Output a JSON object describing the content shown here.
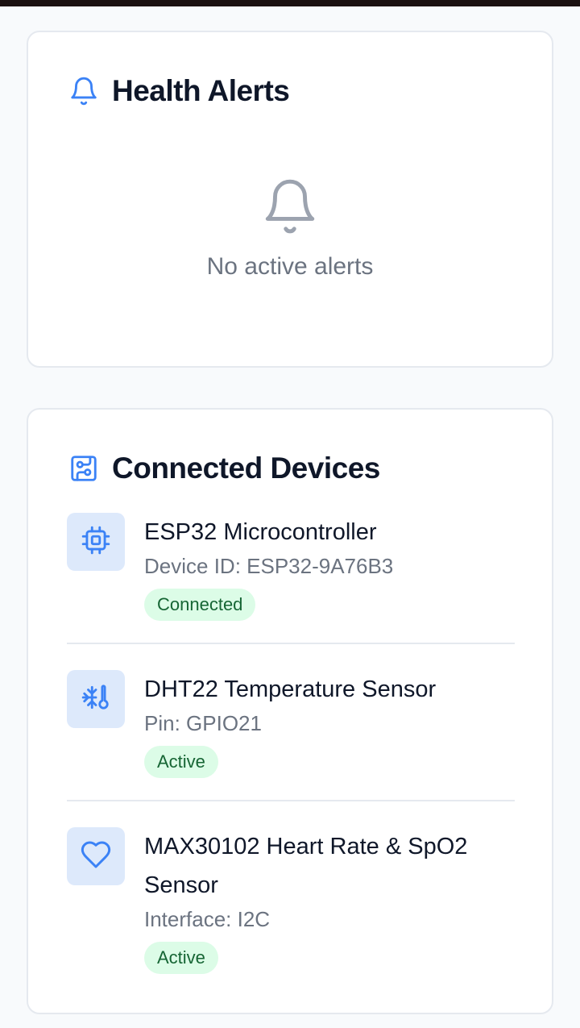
{
  "alerts": {
    "title": "Health Alerts",
    "empty_message": "No active alerts",
    "header_icon": "bell-icon",
    "empty_icon": "bell-icon"
  },
  "devices": {
    "title": "Connected Devices",
    "header_icon": "circuit-board-icon",
    "items": [
      {
        "name": "ESP32 Microcontroller",
        "detail": "Device ID: ESP32-9A76B3",
        "status": "Connected",
        "icon": "cpu-chip-icon"
      },
      {
        "name": "DHT22 Temperature Sensor",
        "detail": "Pin: GPIO21",
        "status": "Active",
        "icon": "thermometer-snowflake-icon"
      },
      {
        "name": "MAX30102 Heart Rate & SpO2 Sensor",
        "detail": "Interface: I2C",
        "status": "Active",
        "icon": "heart-icon"
      }
    ]
  },
  "colors": {
    "accent": "#3b82f6",
    "badge_bg": "#dcfce7",
    "badge_text": "#166534",
    "icon_bg": "#dde9fb",
    "muted_text": "#6b7380",
    "title_text": "#0f1729"
  }
}
